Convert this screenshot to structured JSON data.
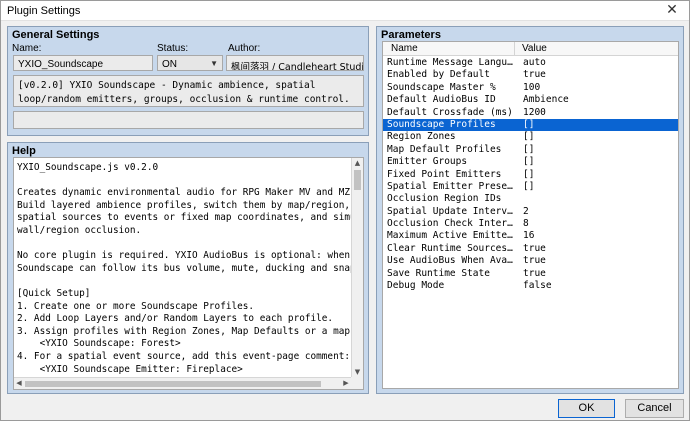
{
  "window": {
    "title": "Plugin Settings"
  },
  "general": {
    "title": "General Settings",
    "name_label": "Name:",
    "name_value": "YXIO_Soundscape",
    "status_label": "Status:",
    "status_value": "ON",
    "author_label": "Author:",
    "author_value": "枫间落羽 / Candleheart Studio",
    "description": "[v0.2.0] YXIO Soundscape - Dynamic ambience, spatial loop/random emitters, groups, occlusion & runtime control."
  },
  "help": {
    "title": "Help",
    "text": "YXIO_Soundscape.js v0.2.0\n\nCreates dynamic environmental audio for RPG Maker MV and MZ.\nBuild layered ambience profiles, switch them by map/region, attach Loop/Random\nspatial sources to events or fixed map coordinates, and simulate distance, st\nwall/region occlusion.\n\nNo core plugin is required. YXIO AudioBus is optional: when detected,\nSoundscape can follow its bus volume, mute, ducking and snapshot state.\n\n[Quick Setup]\n1. Create one or more Soundscape Profiles.\n2. Add Loop Layers and/or Random Layers to each profile.\n3. Assign profiles with Region Zones, Map Defaults or a map note:\n    <YXIO Soundscape: Forest>\n4. For a spatial event source, add this event-page comment:\n    <YXIO Soundscape Emitter: Fireplace>"
  },
  "parameters": {
    "title": "Parameters",
    "col_name": "Name",
    "col_value": "Value",
    "rows": [
      {
        "name": "Runtime Message Language",
        "value": "auto"
      },
      {
        "name": "Enabled by Default",
        "value": "true"
      },
      {
        "name": "Soundscape Master %",
        "value": "100"
      },
      {
        "name": "Default AudioBus ID",
        "value": "Ambience"
      },
      {
        "name": "Default Crossfade (ms)",
        "value": "1200"
      },
      {
        "name": "Soundscape Profiles",
        "value": "[]"
      },
      {
        "name": "Region Zones",
        "value": "[]"
      },
      {
        "name": "Map Default Profiles",
        "value": "[]"
      },
      {
        "name": "Emitter Groups",
        "value": "[]"
      },
      {
        "name": "Fixed Point Emitters",
        "value": "[]"
      },
      {
        "name": "Spatial Emitter Presets",
        "value": "[]"
      },
      {
        "name": "Occlusion Region IDs",
        "value": ""
      },
      {
        "name": "Spatial Update Interval",
        "value": "2"
      },
      {
        "name": "Occlusion Check Interval",
        "value": "8"
      },
      {
        "name": "Maximum Active Emitters",
        "value": "16"
      },
      {
        "name": "Clear Runtime Sources on…",
        "value": "true"
      },
      {
        "name": "Use AudioBus When Availa…",
        "value": "true"
      },
      {
        "name": "Save Runtime State",
        "value": "true"
      },
      {
        "name": "Debug Mode",
        "value": "false"
      }
    ],
    "selected_index": 5
  },
  "buttons": {
    "ok": "OK",
    "cancel": "Cancel"
  },
  "colors": {
    "panel": "#c7d8ec",
    "selection": "#0a64d2"
  }
}
